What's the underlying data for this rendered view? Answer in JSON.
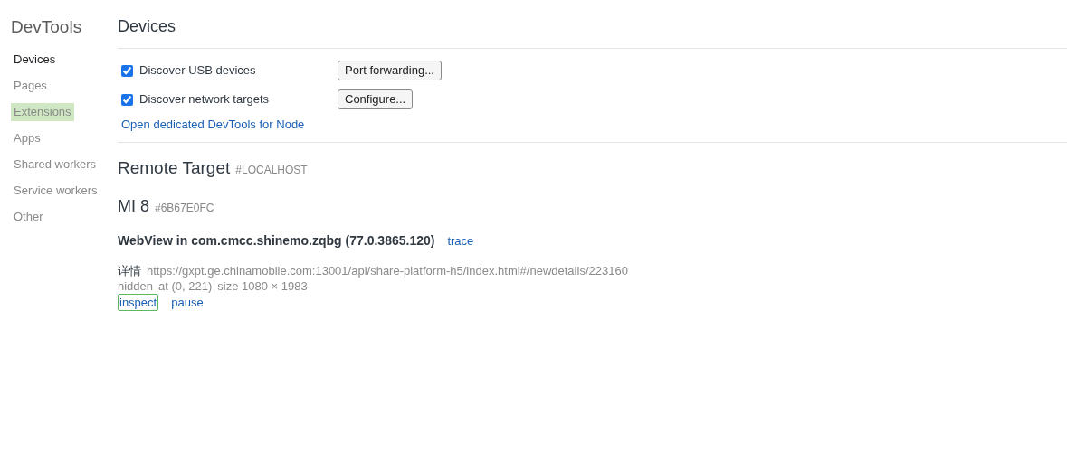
{
  "sidebar": {
    "title": "DevTools",
    "items": [
      {
        "label": "Devices",
        "selected": true,
        "highlighted": false
      },
      {
        "label": "Pages",
        "selected": false,
        "highlighted": false
      },
      {
        "label": "Extensions",
        "selected": false,
        "highlighted": true
      },
      {
        "label": "Apps",
        "selected": false,
        "highlighted": false
      },
      {
        "label": "Shared workers",
        "selected": false,
        "highlighted": false
      },
      {
        "label": "Service workers",
        "selected": false,
        "highlighted": false
      },
      {
        "label": "Other",
        "selected": false,
        "highlighted": false
      }
    ]
  },
  "main": {
    "title": "Devices",
    "options": [
      {
        "label": "Discover USB devices",
        "checked": true,
        "button": "Port forwarding..."
      },
      {
        "label": "Discover network targets",
        "checked": true,
        "button": "Configure..."
      }
    ],
    "node_link": "Open dedicated DevTools for Node",
    "remote_target": {
      "title": "Remote Target",
      "tag": "#LOCALHOST"
    },
    "device": {
      "name": "MI 8",
      "serial": "#6B67E0FC"
    },
    "browser": {
      "title": "WebView in com.cmcc.shinemo.zqbg (77.0.3865.120)",
      "action": "trace"
    },
    "page": {
      "name": "详情",
      "url": "https://gxpt.ge.chinamobile.com:13001/api/share-platform-h5/index.html#/newdetails/223160",
      "state": "hidden",
      "position": "at (0, 221)",
      "size": "size 1080 × 1983",
      "actions": [
        {
          "label": "inspect",
          "focused": true
        },
        {
          "label": "pause",
          "focused": false
        }
      ]
    }
  }
}
